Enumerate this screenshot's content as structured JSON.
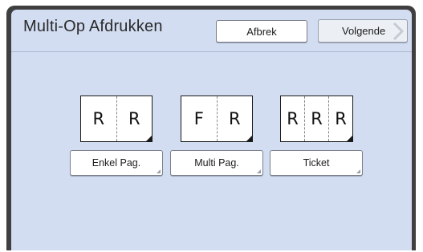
{
  "header": {
    "title": "Multi-Op Afdrukken",
    "cancel_label": "Afbrek",
    "next_label": "Volgende"
  },
  "options": [
    {
      "label": "Enkel Pag.",
      "pages": [
        "R",
        "R"
      ]
    },
    {
      "label": "Multi Pag.",
      "pages": [
        "F",
        "R"
      ]
    },
    {
      "label": "Ticket",
      "pages": [
        "R",
        "R",
        "R"
      ]
    }
  ]
}
